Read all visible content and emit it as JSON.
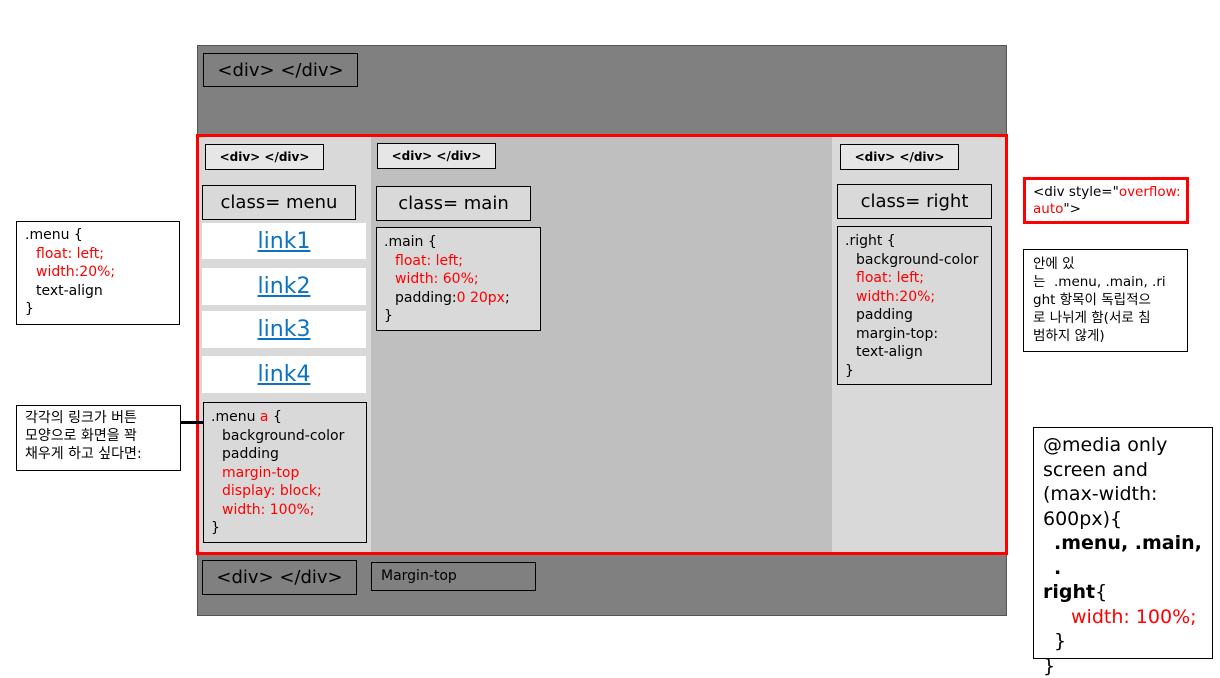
{
  "header": {
    "tag_label": "<div> </div>"
  },
  "footer": {
    "tag_label": "<div> </div>",
    "margin_label": "Margin-top"
  },
  "left": {
    "tag_label": "<div> </div>",
    "class_label": "class= menu",
    "links": [
      "link1",
      "link2",
      "link3",
      "link4"
    ],
    "code": {
      "open_prefix": ".menu ",
      "open_selector": "a",
      "open_suffix": " {",
      "line1": "background-color",
      "line2": "padding",
      "line3": "margin-top",
      "line4": "display: block;",
      "line5": "width: 100%;",
      "close": "}"
    }
  },
  "main": {
    "tag_label": "<div> </div>",
    "class_label": "class= main",
    "code": {
      "open": ".main {",
      "line1": "float: left;",
      "line2": "width: 60%;",
      "line3_prefix": "padding:",
      "line3_value": "0 20px",
      "line3_suffix": ";",
      "close": "}"
    }
  },
  "right": {
    "tag_label": "<div> </div>",
    "class_label": "class= right",
    "code": {
      "open": ".right {",
      "line1": "background-color",
      "line2": "float: left;",
      "line3": "width:20%;",
      "line4": "padding",
      "line5": "margin-top:",
      "line6": "text-align",
      "close": "}"
    }
  },
  "notes": {
    "menu_css": {
      "open": ".menu {",
      "line1": "float: left;",
      "line2": "width:20%;",
      "line3": "text-align",
      "close": "}"
    },
    "link_note": {
      "line1": "각각의 링크가 버튼",
      "line2": "모양으로 화면을 꽉",
      "line3": "채우게 하고 싶다면:"
    },
    "overflow": {
      "prefix": "<div style=\"",
      "value1": "overflow:",
      "value2": "auto",
      "suffix": "\">"
    },
    "independent": {
      "line1": "안에 있",
      "line2": "는  .menu, .main, .ri",
      "line3": "ght 항목이 독립적으",
      "line4": "로 나뉘게 함(서로 침",
      "line5": "범하지 않게)"
    },
    "media": {
      "line1": "@media only",
      "line2": "screen and",
      "line3": "(max-width:",
      "line4": "600px){",
      "line5_bold": ".menu, .main, .",
      "line6_bold": "right",
      "line6_rest": "{",
      "line7": "width: 100%;",
      "line8": "}",
      "line9": "}"
    }
  }
}
